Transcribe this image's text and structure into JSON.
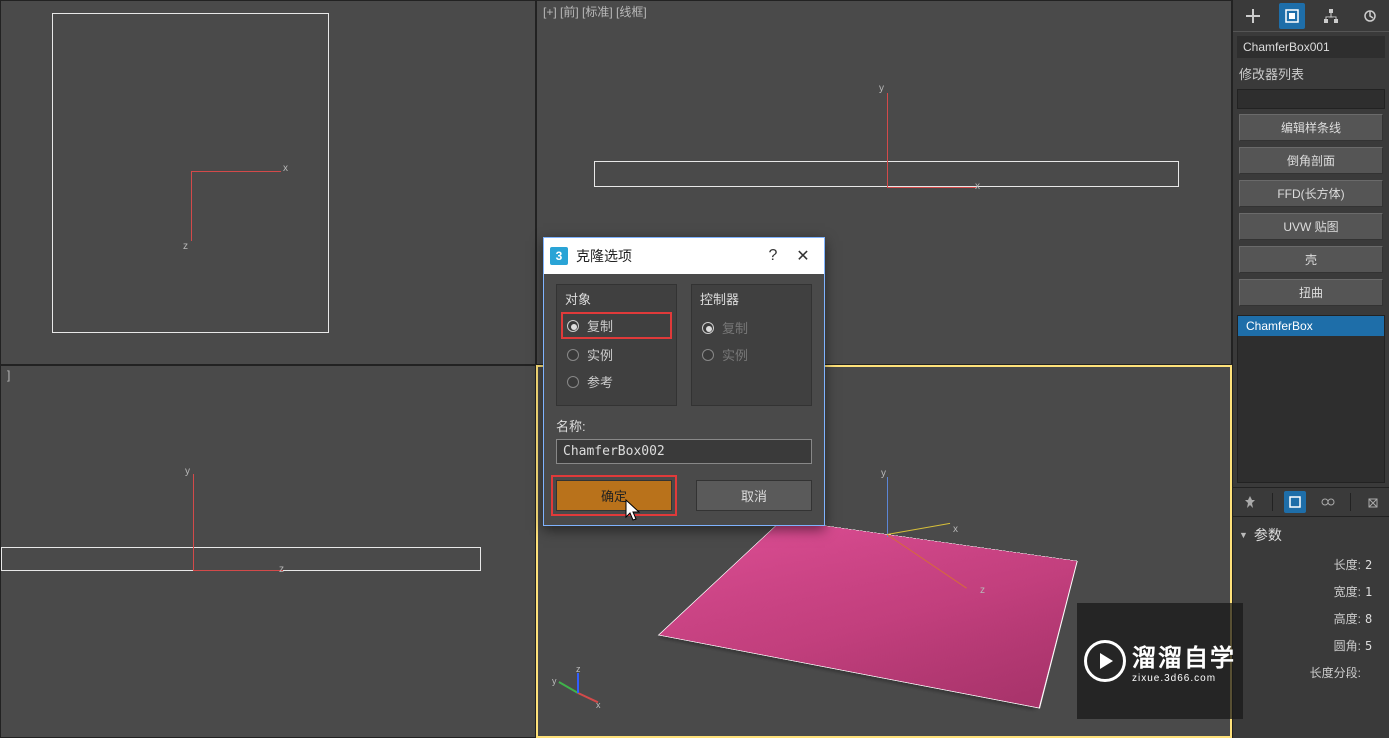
{
  "viewports": {
    "top_left_label": "]",
    "left_bottom_label": "]",
    "front_label": "[+] [前] [标准] [线框]"
  },
  "dialog": {
    "title": "克隆选项",
    "help_tooltip": "?",
    "group_object": "对象",
    "group_controller": "控制器",
    "option_copy": "复制",
    "option_instance": "实例",
    "option_reference": "参考",
    "ctrl_option_copy": "复制",
    "ctrl_option_instance": "实例",
    "name_label": "名称:",
    "name_value": "ChamferBox002",
    "ok_label": "确定",
    "cancel_label": "取消"
  },
  "panel": {
    "object_name": "ChamferBox001",
    "modifier_list_label": "修改器列表",
    "buttons": {
      "edit_spline": "编辑样条线",
      "chamfer_profile": "倒角剖面",
      "ffd_box": "FFD(长方体)",
      "uvw_map": "UVW 贴图",
      "shell": "壳",
      "bend": "扭曲"
    },
    "stack_item": "ChamferBox",
    "rollout_params": "参数",
    "params": {
      "length": "长度:",
      "length_v": "2",
      "width": "宽度:",
      "width_v": "1",
      "height": "高度:",
      "height_v": "8",
      "fillet": "圆角:",
      "fillet_v": "5",
      "length_segs": "长度分段:"
    }
  },
  "watermark": {
    "main": "溜溜自学",
    "sub": "zixue.3d66.com"
  },
  "gizmo": {
    "x": "x",
    "y": "y",
    "z": "z"
  }
}
